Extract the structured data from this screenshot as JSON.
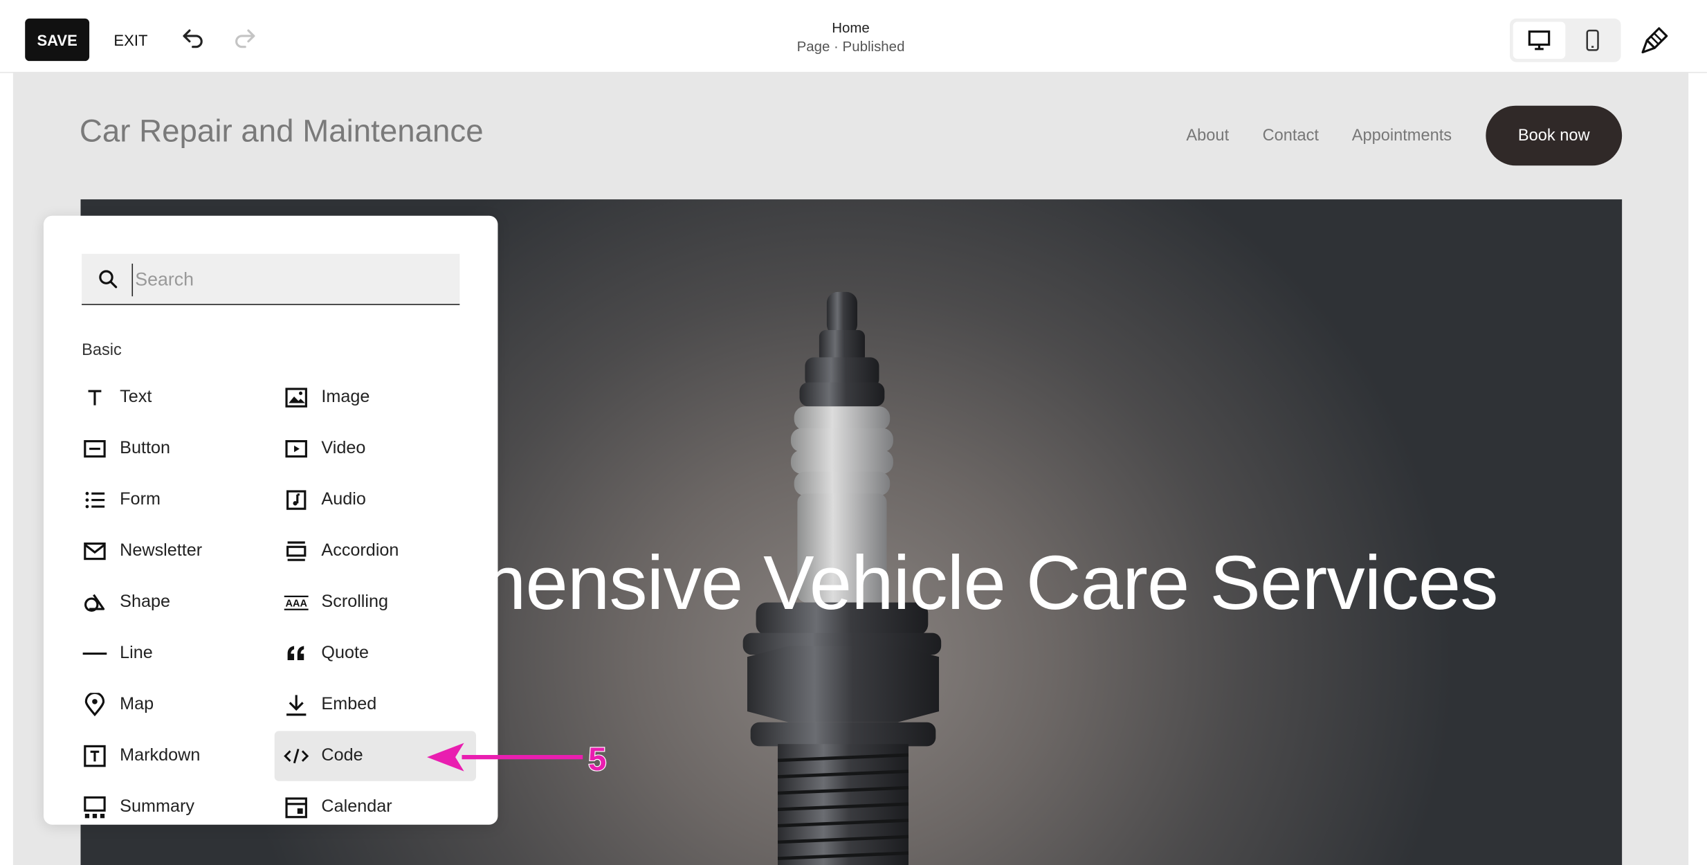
{
  "toolbar": {
    "save_label": "SAVE",
    "exit_label": "EXIT",
    "page_title": "Home",
    "page_status": "Page · Published"
  },
  "site": {
    "title": "Car Repair and Maintenance",
    "nav": [
      "About",
      "Contact",
      "Appointments"
    ],
    "cta_label": "Book now",
    "hero_title": "hensive Vehicle Care Services"
  },
  "panel": {
    "search_placeholder": "Search",
    "section_label": "Basic",
    "blocks": [
      {
        "label": "Text",
        "icon": "text-icon"
      },
      {
        "label": "Image",
        "icon": "image-icon"
      },
      {
        "label": "Button",
        "icon": "button-icon"
      },
      {
        "label": "Video",
        "icon": "video-icon"
      },
      {
        "label": "Form",
        "icon": "form-icon"
      },
      {
        "label": "Audio",
        "icon": "audio-icon"
      },
      {
        "label": "Newsletter",
        "icon": "newsletter-icon"
      },
      {
        "label": "Accordion",
        "icon": "accordion-icon"
      },
      {
        "label": "Shape",
        "icon": "shape-icon"
      },
      {
        "label": "Scrolling",
        "icon": "scrolling-icon"
      },
      {
        "label": "Line",
        "icon": "line-icon"
      },
      {
        "label": "Quote",
        "icon": "quote-icon"
      },
      {
        "label": "Map",
        "icon": "map-icon"
      },
      {
        "label": "Embed",
        "icon": "embed-icon"
      },
      {
        "label": "Markdown",
        "icon": "markdown-icon"
      },
      {
        "label": "Code",
        "icon": "code-icon",
        "highlighted": true
      },
      {
        "label": "Summary",
        "icon": "summary-icon"
      },
      {
        "label": "Calendar",
        "icon": "calendar-icon"
      }
    ]
  },
  "annotation": {
    "label": "5",
    "color": "#e91eb0"
  },
  "colors": {
    "save_bg": "#111111",
    "cta_bg": "#302928",
    "canvas_bg": "#e7e7e7",
    "highlight_bg": "#e8e8e8"
  }
}
